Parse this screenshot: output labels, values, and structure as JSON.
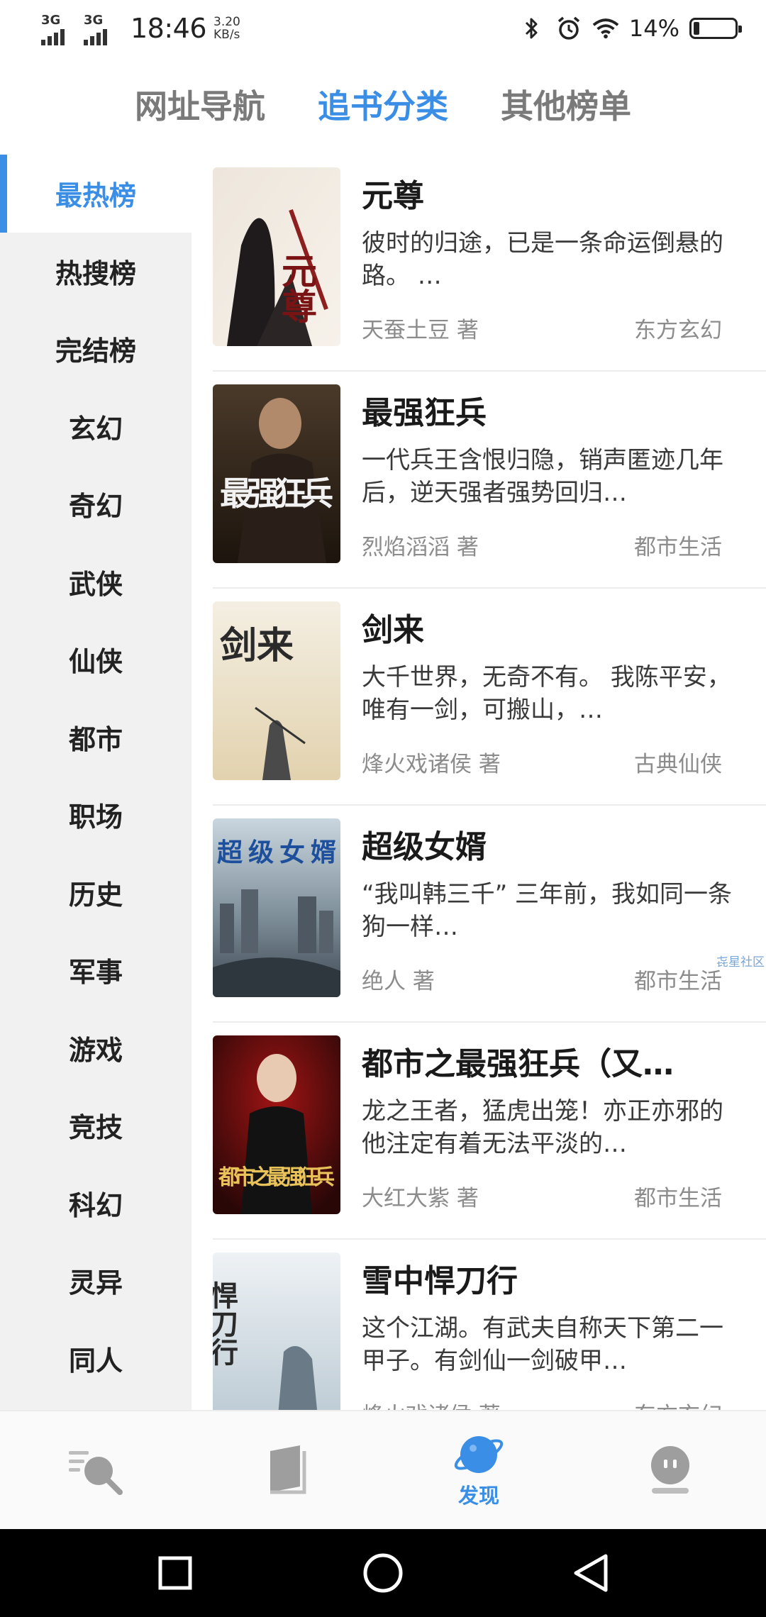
{
  "status_bar": {
    "sim1": "3G",
    "sim2": "3G",
    "time": "18:46",
    "speed_value": "3.20",
    "speed_unit": "KB/s",
    "battery": "14%"
  },
  "top_tabs": [
    {
      "label": "网址导航",
      "active": false
    },
    {
      "label": "追书分类",
      "active": true
    },
    {
      "label": "其他榜单",
      "active": false
    }
  ],
  "sidebar": {
    "items": [
      {
        "label": "最热榜",
        "active": true
      },
      {
        "label": "热搜榜"
      },
      {
        "label": "完结榜"
      },
      {
        "label": "玄幻"
      },
      {
        "label": "奇幻"
      },
      {
        "label": "武侠"
      },
      {
        "label": "仙侠"
      },
      {
        "label": "都市"
      },
      {
        "label": "职场"
      },
      {
        "label": "历史"
      },
      {
        "label": "军事"
      },
      {
        "label": "游戏"
      },
      {
        "label": "竞技"
      },
      {
        "label": "科幻"
      },
      {
        "label": "灵异"
      },
      {
        "label": "同人"
      }
    ]
  },
  "books": [
    {
      "title": "元尊",
      "desc": "彼时的归途，已是一条命运倒悬的路。 …",
      "author": "天蚕土豆 著",
      "category": "东方玄幻"
    },
    {
      "title": "最强狂兵",
      "desc": "一代兵王含恨归隐，销声匿迹几年后，逆天强者强势回归…",
      "author": "烈焰滔滔 著",
      "category": "都市生活"
    },
    {
      "title": "剑来",
      "desc": "大千世界，无奇不有。 我陈平安，唯有一剑，可搬山，…",
      "author": "烽火戏诸侯 著",
      "category": "古典仙侠"
    },
    {
      "title": "超级女婿",
      "desc": "“我叫韩三千” 三年前，我如同一条狗一样…",
      "author": "绝人 著",
      "category": "都市生活"
    },
    {
      "title": "都市之最强狂兵（又…",
      "desc": "龙之王者，猛虎出笼！亦正亦邪的他注定有着无法平淡的…",
      "author": "大红大紫 著",
      "category": "都市生活"
    },
    {
      "title": "雪中悍刀行",
      "desc": "这个江湖。有武夫自称天下第二一甲子。有剑仙一剑破甲…",
      "author": "烽火戏诸侯 著",
      "category": "东方玄幻"
    }
  ],
  "covers": [
    {
      "text": "元尊"
    },
    {
      "text": "最强狂兵"
    },
    {
      "text": "剑来"
    },
    {
      "text": "超级女婿"
    },
    {
      "text": "都市之最强狂兵"
    },
    {
      "text": "悍刀行"
    }
  ],
  "watermark": "㐂星社区",
  "bottom_nav": {
    "active_label": "发现"
  },
  "colors": {
    "accent": "#3a8ee6",
    "sidebar_bg": "#f1f1f1",
    "muted_text": "#8c8c8c"
  }
}
